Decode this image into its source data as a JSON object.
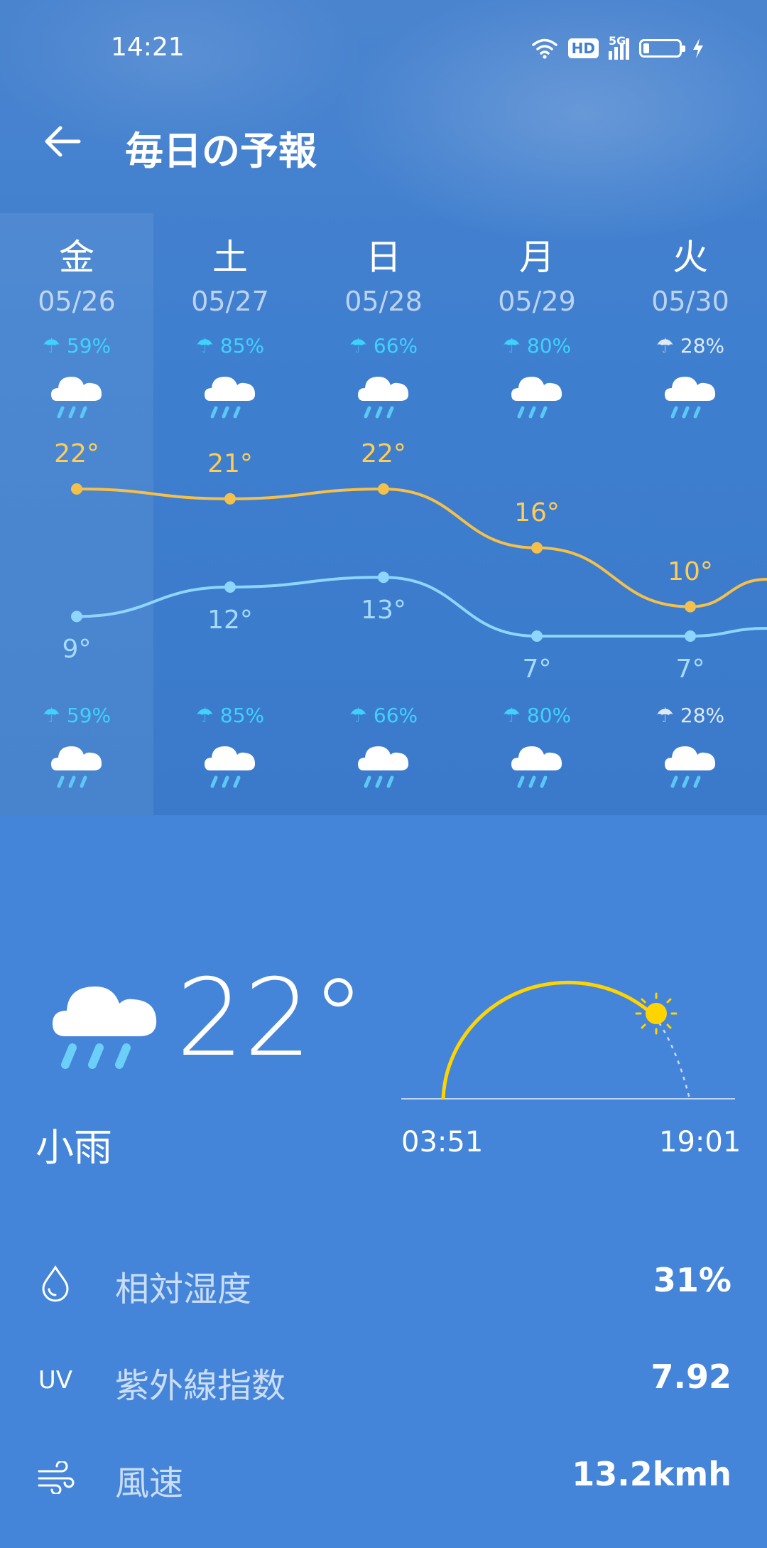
{
  "status_bar": {
    "time": "14:21",
    "hd_label": "HD",
    "network_label": "5G"
  },
  "header": {
    "title": "毎日の予報"
  },
  "days": [
    {
      "weekday": "金",
      "date": "05/26",
      "precip_top": "59%",
      "precip_bottom": "59%",
      "high": "22°",
      "low": "9°"
    },
    {
      "weekday": "土",
      "date": "05/27",
      "precip_top": "85%",
      "precip_bottom": "85%",
      "high": "21°",
      "low": "12°"
    },
    {
      "weekday": "日",
      "date": "05/28",
      "precip_top": "66%",
      "precip_bottom": "66%",
      "high": "22°",
      "low": "13°"
    },
    {
      "weekday": "月",
      "date": "05/29",
      "precip_top": "80%",
      "precip_bottom": "80%",
      "high": "16°",
      "low": "7°"
    },
    {
      "weekday": "火",
      "date": "05/30",
      "precip_top": "28%",
      "precip_bottom": "28%",
      "high": "10°",
      "low": "7°"
    }
  ],
  "chart_data": {
    "type": "line",
    "categories": [
      "05/26",
      "05/27",
      "05/28",
      "05/29",
      "05/30"
    ],
    "series": [
      {
        "values": [
          22,
          21,
          22,
          16,
          10
        ],
        "color": "#f5c04a"
      },
      {
        "values": [
          9,
          12,
          13,
          7,
          7
        ],
        "color": "#8fd6ff"
      }
    ],
    "ylim": [
      5,
      24
    ],
    "grid": false
  },
  "current": {
    "temperature": "22°",
    "condition": "小雨",
    "sunrise": "03:51",
    "sunset": "19:01",
    "icon": "rain-cloud-icon"
  },
  "metrics": [
    {
      "icon": "humidity-drop-icon",
      "label": "相対湿度",
      "value": "31%"
    },
    {
      "icon": "uv-icon",
      "icon_text": "UV",
      "label": "紫外線指数",
      "value": "7.92"
    },
    {
      "icon": "wind-icon",
      "label": "風速",
      "value": "13.2kmh"
    }
  ],
  "colors": {
    "high_line": "#f5c04a",
    "low_line": "#8fd6ff",
    "precip": "#3fd2ff",
    "sun": "#ffd400"
  }
}
